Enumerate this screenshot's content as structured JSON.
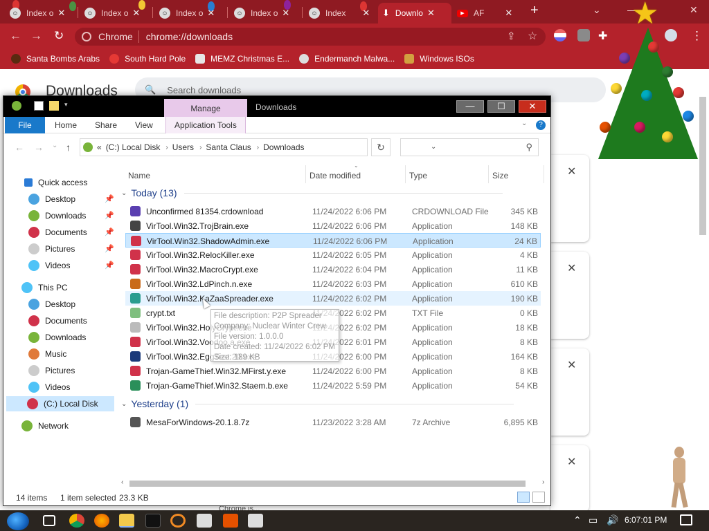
{
  "browser": {
    "tabs": [
      {
        "label": "Index o",
        "active": false
      },
      {
        "label": "Index o",
        "active": false
      },
      {
        "label": "Index o",
        "active": false
      },
      {
        "label": "Index o",
        "active": false
      },
      {
        "label": "Index",
        "active": false
      },
      {
        "label": "Downlo",
        "active": true
      },
      {
        "label": "AF",
        "active": false
      }
    ],
    "omnibox_site": "Chrome",
    "omnibox_url": "chrome://downloads",
    "bookmarks": [
      "Santa Bombs Arabs",
      "South Hard Pole",
      "MEMZ Christmas E...",
      "Endermanch Malwa...",
      "Windows ISOs"
    ],
    "colors": {
      "tabstrip": "#8f1a22",
      "toolbar": "#b4222b"
    }
  },
  "downloads_page": {
    "title": "Downloads",
    "search_placeholder": "Search downloads",
    "footer_partial": "Chrome is..."
  },
  "explorer": {
    "manage_tab": "Manage",
    "window_title": "Downloads",
    "ribbon_tabs": [
      "File",
      "Home",
      "Share",
      "View",
      "Application Tools"
    ],
    "address": {
      "root": "«",
      "crumbs": [
        "(C:) Local Disk",
        "Users",
        "Santa Claus",
        "Downloads"
      ]
    },
    "search_placeholder": "",
    "nav": {
      "quick_access": "Quick access",
      "quick_items": [
        "Desktop",
        "Downloads",
        "Documents",
        "Pictures",
        "Videos"
      ],
      "this_pc": "This PC",
      "pc_items": [
        "Desktop",
        "Documents",
        "Downloads",
        "Music",
        "Pictures",
        "Videos",
        "(C:) Local Disk"
      ],
      "network": "Network"
    },
    "columns": {
      "name": "Name",
      "date": "Date modified",
      "type": "Type",
      "size": "Size"
    },
    "groups": {
      "today": "Today (13)",
      "yesterday": "Yesterday (1)"
    },
    "files_today": [
      {
        "name": "Unconfirmed 81354.crdownload",
        "date": "11/24/2022 6:06 PM",
        "type": "CRDOWNLOAD File",
        "size": "345 KB",
        "icon": "crdownload-icon",
        "color": "#5a3fb0"
      },
      {
        "name": "VirTool.Win32.TrojBrain.exe",
        "date": "11/24/2022 6:06 PM",
        "type": "Application",
        "size": "148 KB",
        "icon": "exe-icon",
        "color": "#444444"
      },
      {
        "name": "VirTool.Win32.ShadowAdmin.exe",
        "date": "11/24/2022 6:06 PM",
        "type": "Application",
        "size": "24 KB",
        "icon": "exe-icon",
        "color": "#d0324a"
      },
      {
        "name": "VirTool.Win32.RelocKiller.exe",
        "date": "11/24/2022 6:05 PM",
        "type": "Application",
        "size": "4 KB",
        "icon": "exe-icon",
        "color": "#d0324a"
      },
      {
        "name": "VirTool.Win32.MacroCrypt.exe",
        "date": "11/24/2022 6:04 PM",
        "type": "Application",
        "size": "11 KB",
        "icon": "exe-icon",
        "color": "#d0324a"
      },
      {
        "name": "VirTool.Win32.LdPinch.n.exe",
        "date": "11/24/2022 6:03 PM",
        "type": "Application",
        "size": "610 KB",
        "icon": "exe-icon",
        "color": "#c96a1a"
      },
      {
        "name": "VirTool.Win32.KaZaaSpreader.exe",
        "date": "11/24/2022 6:02 PM",
        "type": "Application",
        "size": "190 KB",
        "icon": "exe-icon",
        "color": "#2a9d8f"
      },
      {
        "name": "crypt.txt",
        "date": "11/24/2022 6:02 PM",
        "type": "TXT File",
        "size": "0 KB",
        "icon": "txt-icon",
        "color": "#7fbf7f"
      },
      {
        "name": "VirTool.Win32.HolyCrypt.exe",
        "date": "11/24/2022 6:02 PM",
        "type": "Application",
        "size": "18 KB",
        "icon": "exe-icon",
        "color": "#bbbbbb"
      },
      {
        "name": "VirTool.Win32.Voodoo.a.exe",
        "date": "11/24/2022 6:01 PM",
        "type": "Application",
        "size": "8 KB",
        "icon": "exe-icon",
        "color": "#d0324a"
      },
      {
        "name": "VirTool.Win32.EggTest.20.exe",
        "date": "11/24/2022 6:00 PM",
        "type": "Application",
        "size": "164 KB",
        "icon": "exe-icon",
        "color": "#1b3a7a"
      },
      {
        "name": "Trojan-GameThief.Win32.MFirst.y.exe",
        "date": "11/24/2022 6:00 PM",
        "type": "Application",
        "size": "8 KB",
        "icon": "exe-icon",
        "color": "#d0324a"
      },
      {
        "name": "Trojan-GameThief.Win32.Staem.b.exe",
        "date": "11/24/2022 5:59 PM",
        "type": "Application",
        "size": "54 KB",
        "icon": "exe-icon",
        "color": "#2a8f5a"
      }
    ],
    "files_yesterday": [
      {
        "name": "MesaForWindows-20.1.8.7z",
        "date": "11/23/2022 3:28 AM",
        "type": "7z Archive",
        "size": "6,895 KB",
        "icon": "archive-icon",
        "color": "#555555"
      }
    ],
    "tooltip": [
      "File description: P2P Spreader",
      "Company: Nuclear Winter Crew",
      "File version: 1.0.0.0",
      "Date created: 11/24/2022 6:02 PM",
      "Size: 189 KB"
    ],
    "status": {
      "items": "14 items",
      "selected": "1 item selected",
      "size": "23.3 KB"
    }
  },
  "taskbar": {
    "clock": "6:07:01 PM"
  }
}
